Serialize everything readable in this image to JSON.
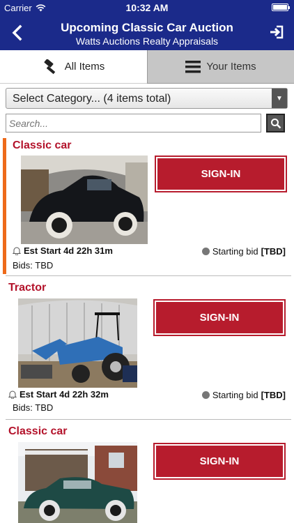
{
  "status_bar": {
    "carrier": "Carrier",
    "time": "10:32 AM"
  },
  "header": {
    "title": "Upcoming Classic Car Auction",
    "subtitle": "Watts Auctions Realty Appraisals",
    "back_icon": "chevron-left-icon",
    "login_icon": "sign-in-icon"
  },
  "tabs": [
    {
      "label": "All Items",
      "icon": "gavel-icon",
      "selected": true
    },
    {
      "label": "Your Items",
      "icon": "list-icon",
      "selected": false
    }
  ],
  "category": {
    "label": "Select Category... (4 items total)"
  },
  "search": {
    "placeholder": "Search..."
  },
  "items": [
    {
      "name": "Classic car",
      "photo": "black classic coupe in garage",
      "button": "SIGN-IN",
      "est_start": "Est Start 4d 22h 31m",
      "bid_label": "Starting bid",
      "bid_value": "[TBD]",
      "bids": "Bids: TBD"
    },
    {
      "name": "Tractor",
      "photo": "blue tractor with front loader",
      "button": "SIGN-IN",
      "est_start": "Est Start 4d 22h 32m",
      "bid_label": "Starting bid",
      "bid_value": "[TBD]",
      "bids": "Bids: TBD"
    },
    {
      "name": "Classic car",
      "photo": "green classic car by house",
      "button": "SIGN-IN"
    }
  ],
  "colors": {
    "navbar": "#1b2a8a",
    "accent": "#b71c2d",
    "selected_bar": "#ee6a1a"
  }
}
